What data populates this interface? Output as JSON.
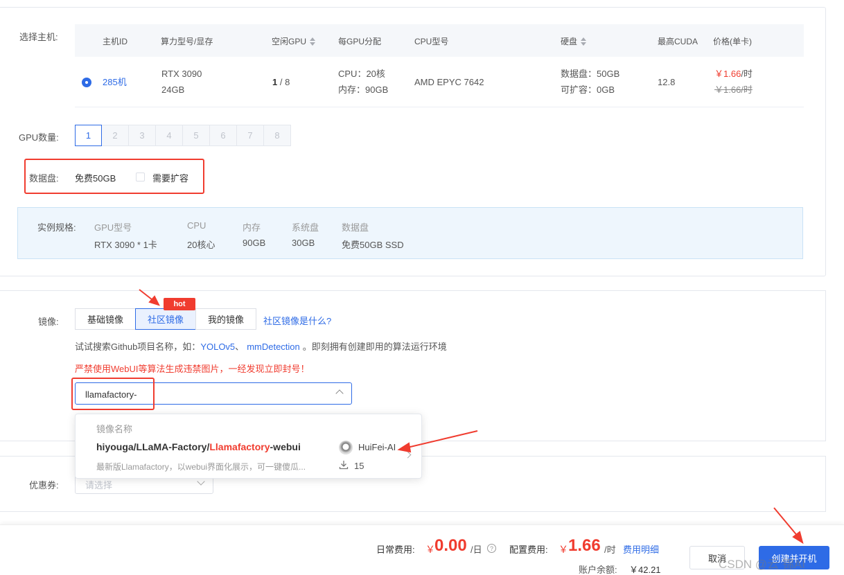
{
  "host": {
    "label": "选择主机:",
    "columns": [
      "主机ID",
      "算力型号/显存",
      "空闲GPU",
      "每GPU分配",
      "CPU型号",
      "硬盘",
      "最高CUDA",
      "价格(单卡)"
    ],
    "row": {
      "id": "285机",
      "model": "RTX 3090",
      "vram": "24GB",
      "free_gpu_num": "1",
      "free_gpu_total": " / 8",
      "cpu_alloc": "CPU：20核",
      "mem_alloc": "内存：90GB",
      "cpu_model": "AMD EPYC 7642",
      "disk_data": "数据盘：50GB",
      "disk_ext": "可扩容：0GB",
      "cuda": "12.8",
      "price": "￥1.66",
      "price_unit": "/时",
      "price_old": "￥1.66/时"
    }
  },
  "gpu_count": {
    "label": "GPU数量:",
    "options": [
      "1",
      "2",
      "3",
      "4",
      "5",
      "6",
      "7",
      "8"
    ],
    "selected": "1"
  },
  "data_disk": {
    "label": "数据盘:",
    "value": "免费50GB",
    "expand_label": "需要扩容"
  },
  "spec": {
    "label": "实例规格:",
    "items": [
      {
        "key": "GPU型号",
        "value": "RTX 3090 * 1卡"
      },
      {
        "key": "CPU",
        "value": "20核心"
      },
      {
        "key": "内存",
        "value": "90GB"
      },
      {
        "key": "系统盘",
        "value": "30GB"
      },
      {
        "key": "数据盘",
        "value": "免费50GB SSD"
      }
    ]
  },
  "image": {
    "label": "镜像:",
    "tabs": [
      "基础镜像",
      "社区镜像",
      "我的镜像"
    ],
    "active_tab": "社区镜像",
    "hot_badge": "hot",
    "what_link": "社区镜像是什么?",
    "hint_prefix": "试试搜索Github项目名称，如：",
    "hint_link1": "YOLOv5",
    "hint_sep": "、",
    "hint_link2": "mmDetection",
    "hint_suffix": "。即刻拥有创建即用的算法运行环境",
    "warning": "严禁使用WebUI等算法生成违禁图片，一经发现立即封号！",
    "search_value": "llamafactory-"
  },
  "dropdown": {
    "header": "镜像名称",
    "item": {
      "name_prefix": "hiyouga/LLaMA-Factory/",
      "name_highlight": "Llamafactory",
      "name_suffix": "-webui",
      "author": "HuiFei-AI",
      "description": "最新版Llamafactory，以webui界面化展示，可一键傻瓜...",
      "downloads": "15"
    }
  },
  "coupon": {
    "label": "优惠券:",
    "placeholder": "请选择"
  },
  "footer": {
    "daily_label": "日常费用:",
    "daily_currency": "￥",
    "daily_value": "0.00",
    "daily_unit": "/日",
    "config_label": "配置费用:",
    "config_currency": "￥",
    "config_value": "1.66",
    "config_unit": "/时",
    "detail_link": "费用明细",
    "balance_label": "账户余额:",
    "balance_value": "￥42.21",
    "cancel": "取消",
    "create": "创建并开机",
    "watermark": "CSDN @云 锦AI"
  },
  "colors": {
    "primary": "#2e6be6",
    "danger": "#f03c2f",
    "spec_bg": "#eef6fd"
  }
}
